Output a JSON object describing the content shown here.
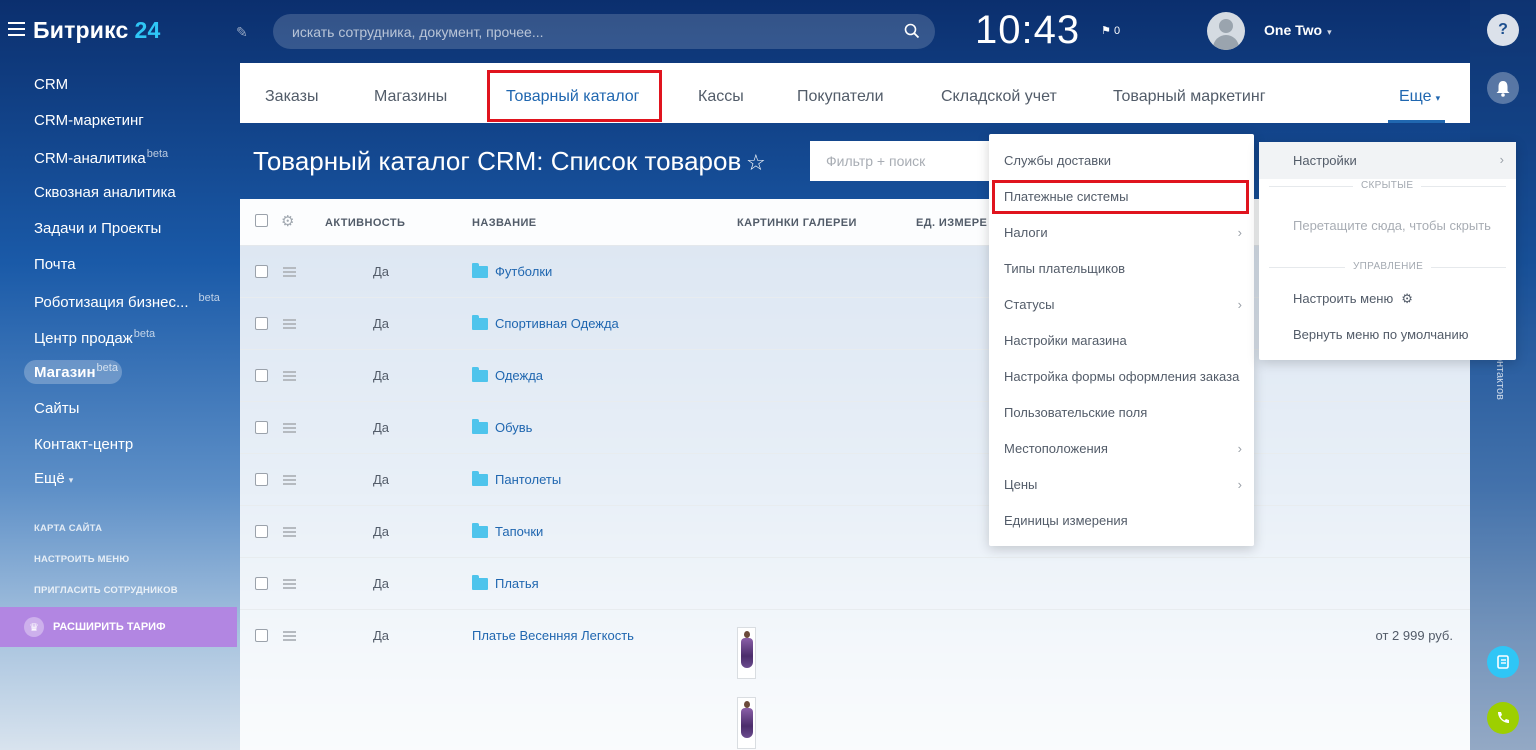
{
  "header": {
    "logo_text": "Битрикс",
    "logo_num": "24",
    "search_placeholder": "искать сотрудника, документ, прочее...",
    "time": "10:43",
    "flag_count": "0",
    "user_name": "One Two"
  },
  "leftmenu": {
    "items": [
      {
        "label": "CRM",
        "beta": ""
      },
      {
        "label": "CRM-маркетинг",
        "beta": ""
      },
      {
        "label": "CRM-аналитика",
        "beta": "beta"
      },
      {
        "label": "Сквозная аналитика",
        "beta": ""
      },
      {
        "label": "Задачи и Проекты",
        "beta": ""
      },
      {
        "label": "Почта",
        "beta": ""
      },
      {
        "label": "Роботизация бизнес...",
        "beta": "beta"
      },
      {
        "label": "Центр продаж",
        "beta": "beta"
      },
      {
        "label": "Магазин",
        "beta": "beta"
      },
      {
        "label": "Сайты",
        "beta": ""
      },
      {
        "label": "Контакт-центр",
        "beta": ""
      },
      {
        "label": "Ещё",
        "beta": ""
      }
    ],
    "small_links": [
      "КАРТА САЙТА",
      "НАСТРОИТЬ МЕНЮ",
      "ПРИГЛАСИТЬ СОТРУДНИКОВ"
    ],
    "upgrade_label": "РАСШИРИТЬ ТАРИФ"
  },
  "tabs": {
    "items": [
      "Заказы",
      "Магазины",
      "Товарный каталог",
      "Кассы",
      "Покупатели",
      "Складской учет",
      "Товарный маркетинг"
    ],
    "more_label": "Еще"
  },
  "page": {
    "title": "Товарный каталог CRM: Список товаров",
    "filter_placeholder": "Фильтр + поиск"
  },
  "grid": {
    "columns": [
      "АКТИВНОСТЬ",
      "НАЗВАНИЕ",
      "КАРТИНКИ ГАЛЕРЕИ",
      "ЕД. ИЗМЕРЕ"
    ],
    "rows": [
      {
        "active": "Да",
        "name": "Футболки",
        "folder": true,
        "price": ""
      },
      {
        "active": "Да",
        "name": "Спортивная Одежда",
        "folder": true,
        "price": ""
      },
      {
        "active": "Да",
        "name": "Одежда",
        "folder": true,
        "price": ""
      },
      {
        "active": "Да",
        "name": "Обувь",
        "folder": true,
        "price": ""
      },
      {
        "active": "Да",
        "name": "Пантолеты",
        "folder": true,
        "price": ""
      },
      {
        "active": "Да",
        "name": "Тапочки",
        "folder": true,
        "price": ""
      },
      {
        "active": "Да",
        "name": "Платья",
        "folder": true,
        "price": ""
      },
      {
        "active": "Да",
        "name": "Платье Весенняя Легкость",
        "folder": false,
        "price": "от 2 999 руб."
      }
    ]
  },
  "menu_more": {
    "items": [
      {
        "label": "Службы доставки",
        "submenu": false
      },
      {
        "label": "Платежные системы",
        "submenu": false
      },
      {
        "label": "Налоги",
        "submenu": true
      },
      {
        "label": "Типы плательщиков",
        "submenu": false
      },
      {
        "label": "Статусы",
        "submenu": true
      },
      {
        "label": "Настройки магазина",
        "submenu": false
      },
      {
        "label": "Настройка формы оформления заказа",
        "submenu": false
      },
      {
        "label": "Пользовательские поля",
        "submenu": false
      },
      {
        "label": "Местоположения",
        "submenu": true
      },
      {
        "label": "Цены",
        "submenu": true
      },
      {
        "label": "Единицы измерения",
        "submenu": false
      }
    ]
  },
  "menu_settings": {
    "settings_label": "Настройки",
    "hidden_caption": "СКРЫТЫЕ",
    "hidden_hint": "Перетащите сюда, чтобы скрыть",
    "manage_caption": "УПРАВЛЕНИЕ",
    "configure_label": "Настроить меню",
    "reset_label": "Вернуть меню по умолчанию"
  },
  "rightstrip": {
    "vertical_label": "контактов"
  },
  "colors": {
    "accent": "#2067b0",
    "highlight": "#e0141e",
    "upgrade": "#b286e2",
    "folder": "#4ec4ec"
  }
}
